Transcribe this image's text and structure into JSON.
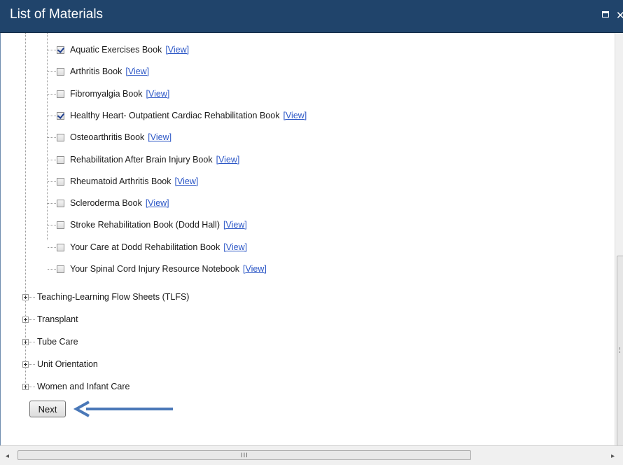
{
  "dialog": {
    "title": "List of Materials"
  },
  "books": [
    {
      "label": "Aquatic Exercises Book",
      "link": "[View]",
      "checked": true
    },
    {
      "label": "Arthritis Book",
      "link": "[View]",
      "checked": false
    },
    {
      "label": "Fibromyalgia Book",
      "link": "[View]",
      "checked": false
    },
    {
      "label": "Healthy Heart- Outpatient Cardiac Rehabilitation Book",
      "link": "[View]",
      "checked": true
    },
    {
      "label": "Osteoarthritis Book",
      "link": "[View]",
      "checked": false
    },
    {
      "label": "Rehabilitation After Brain Injury Book",
      "link": "[View]",
      "checked": false
    },
    {
      "label": "Rheumatoid Arthritis Book",
      "link": "[View]",
      "checked": false
    },
    {
      "label": "Scleroderma Book",
      "link": "[View]",
      "checked": false
    },
    {
      "label": "Stroke Rehabilitation Book (Dodd Hall)",
      "link": "[View]",
      "checked": false
    },
    {
      "label": "Your Care at Dodd Rehabilitation Book",
      "link": "[View]",
      "checked": false
    },
    {
      "label": "Your Spinal Cord Injury Resource Notebook",
      "link": "[View]",
      "checked": false
    }
  ],
  "categories": [
    {
      "label": "Teaching-Learning Flow Sheets (TLFS)"
    },
    {
      "label": "Transplant"
    },
    {
      "label": "Tube Care"
    },
    {
      "label": "Unit Orientation"
    },
    {
      "label": "Women and Infant Care"
    }
  ],
  "actions": {
    "next_label": "Next"
  },
  "scrollbar": {
    "grip": "III"
  },
  "colors": {
    "titlebar": "#20446b",
    "link": "#2b56c6",
    "annotation_arrow": "#4a78b8"
  }
}
